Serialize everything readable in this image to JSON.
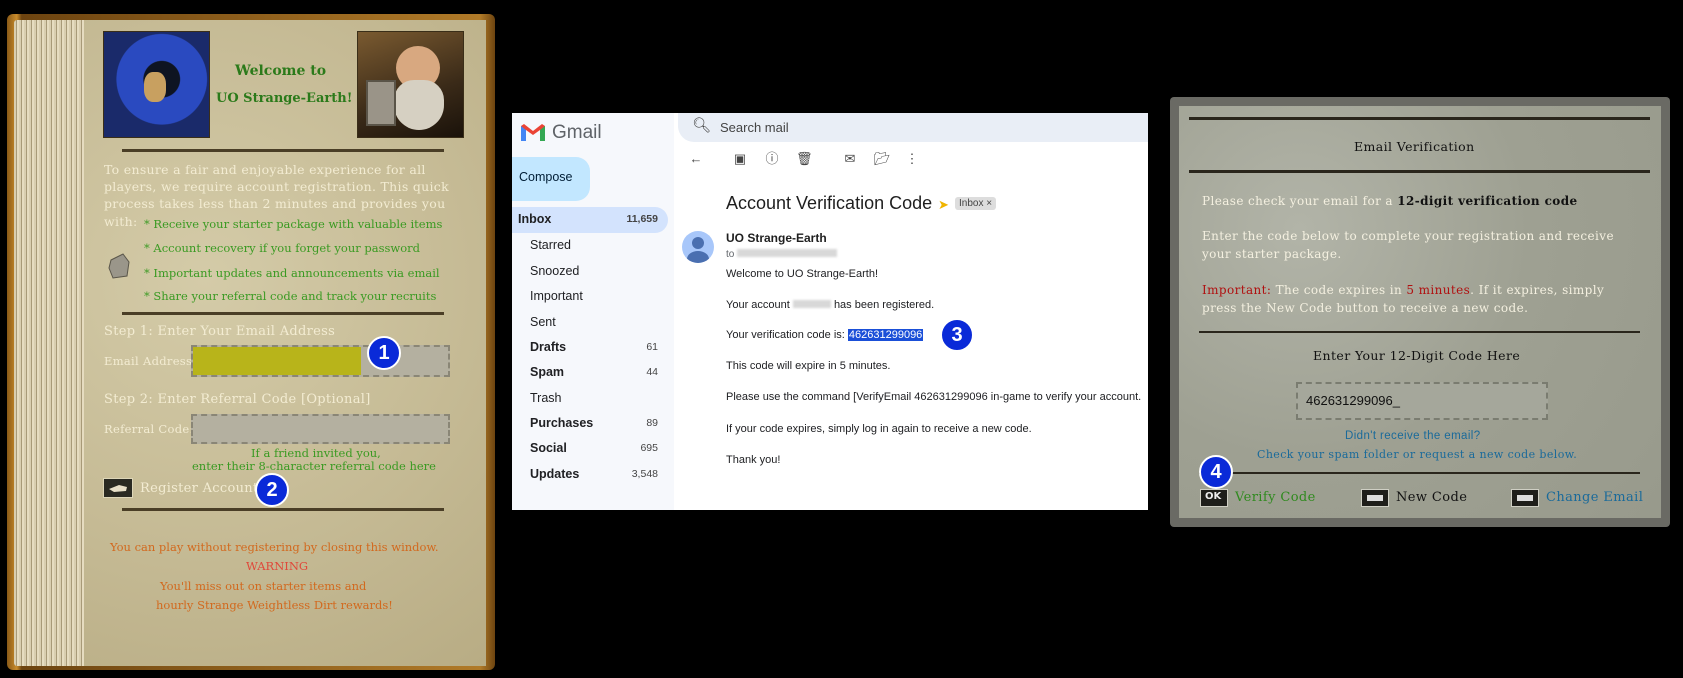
{
  "book": {
    "welcome_line1": "Welcome to",
    "welcome_line2": "UO Strange-Earth!",
    "intro_lines": [
      "To ensure a fair and enjoyable experience for all",
      "players, we require account registration. This quick",
      "process takes less than 2 minutes and provides you",
      "with:"
    ],
    "benefits": [
      "* Receive your starter package with valuable items",
      "* Account recovery if you forget your password",
      "* Important updates and announcements via email",
      "* Share your referral code and track your recruits"
    ],
    "step1_title": "Step 1: Enter Your Email Address",
    "email_label": "Email Address:",
    "step2_title": "Step 2: Enter Referral Code [Optional]",
    "referral_label": "Referral Code:",
    "referral_hint1": "If a friend invited you,",
    "referral_hint2": "enter their 8-character referral code here",
    "register_label": "Register Account",
    "footer_line1": "You can play without registering by closing this window.",
    "warning": "WARNING",
    "footer_line2": "You'll miss out on starter items and",
    "footer_line3": "hourly Strange Weightless Dirt rewards!",
    "colors": {
      "green": "#2b7a1a",
      "orange": "#d2691e",
      "warning": "#e0483a",
      "email_fill": "#b8b41a"
    }
  },
  "gmail": {
    "logo_text": "Gmail",
    "search_placeholder": "Search mail",
    "compose_label": "Compose",
    "nav": [
      {
        "label": "Inbox",
        "count": "11,659"
      },
      {
        "label": "Starred",
        "count": ""
      },
      {
        "label": "Snoozed",
        "count": ""
      },
      {
        "label": "Important",
        "count": ""
      },
      {
        "label": "Sent",
        "count": ""
      },
      {
        "label": "Drafts",
        "count": "61"
      },
      {
        "label": "Spam",
        "count": "44"
      },
      {
        "label": "Trash",
        "count": ""
      },
      {
        "label": "Purchases",
        "count": "89"
      },
      {
        "label": "Social",
        "count": "695"
      },
      {
        "label": "Updates",
        "count": "3,548"
      }
    ],
    "subject": "Account Verification Code",
    "label_chip": "Inbox",
    "sender": "UO Strange-Earth",
    "to_prefix": "to",
    "body": [
      "Welcome to UO Strange-Earth!",
      "Your account",
      "has been registered.",
      "Your verification code is:",
      "462631299096",
      "This code will expire in 5 minutes.",
      "Please use the command [VerifyEmail 462631299096 in-game to verify your account.",
      "If your code expires, simply log in again to receive a new code.",
      "Thank you!"
    ]
  },
  "dialog": {
    "title": "Email Verification",
    "line1_pre": "Please check your email for a",
    "line1_bold": "12-digit verification code",
    "line2a": "Enter the code below to complete your registration and receive",
    "line2b": "your starter package.",
    "important_label": "Important:",
    "imp_a": "The code expires in",
    "imp_mins": "5 minutes",
    "imp_b": ". If it expires, simply",
    "imp_c": "press the New Code button to receive a new code.",
    "enter_title": "Enter Your 12-Digit Code Here",
    "code_value": "462631299096_",
    "didnt_receive": "Didn't receive the email?",
    "check_spam": "Check your spam folder or request a new code below.",
    "ok_text": "OK",
    "verify_label": "Verify Code",
    "newcode_label": "New Code",
    "change_label": "Change Email",
    "colors": {
      "verify": "#2f8a1e",
      "change": "#1a6a9a",
      "important": "#b01010"
    }
  },
  "badges": [
    "1",
    "2",
    "3",
    "4"
  ]
}
